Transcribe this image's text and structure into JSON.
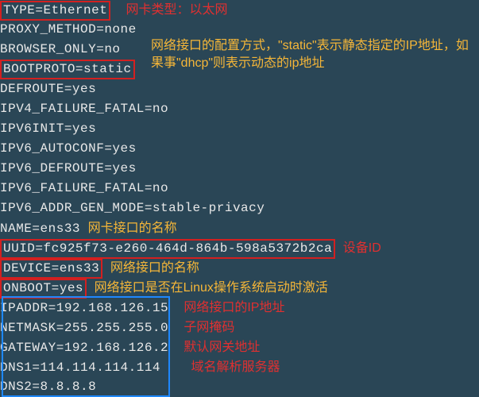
{
  "lines": {
    "type": "TYPE=Ethernet",
    "proxy": "PROXY_METHOD=none",
    "browser": "BROWSER_ONLY=no",
    "bootproto": "BOOTPROTO=static",
    "defroute": "DEFROUTE=yes",
    "ipv4fail": "IPV4_FAILURE_FATAL=no",
    "ipv6init": "IPV6INIT=yes",
    "ipv6auto": "IPV6_AUTOCONF=yes",
    "ipv6def": "IPV6_DEFROUTE=yes",
    "ipv6fail": "IPV6_FAILURE_FATAL=no",
    "ipv6addr": "IPV6_ADDR_GEN_MODE=stable-privacy",
    "name": "NAME=ens33",
    "uuid": "UUID=fc925f73-e260-464d-864b-598a5372b2ca",
    "device": "DEVICE=ens33",
    "onboot": "ONBOOT=yes",
    "ipaddr": "IPADDR=192.168.126.15",
    "netmask": "NETMASK=255.255.255.0",
    "gateway": "GATEWAY=192.168.126.2",
    "dns1": "DNS1=114.114.114.114",
    "dns2": "DNS2=8.8.8.8"
  },
  "ann": {
    "type": "网卡类型：以太网",
    "bootproto": "网络接口的配置方式，\"static\"表示静态指定的IP地址，如果事\"dhcp\"则表示动态的ip地址",
    "name": "网卡接口的名称",
    "uuid": "设备ID",
    "device": "网络接口的名称",
    "onboot": "网络接口是否在Linux操作系统启动时激活",
    "ipaddr": "网络接口的IP地址",
    "netmask": "子网掩码",
    "gateway": "默认网关地址",
    "dns": "域名解析服务器"
  }
}
